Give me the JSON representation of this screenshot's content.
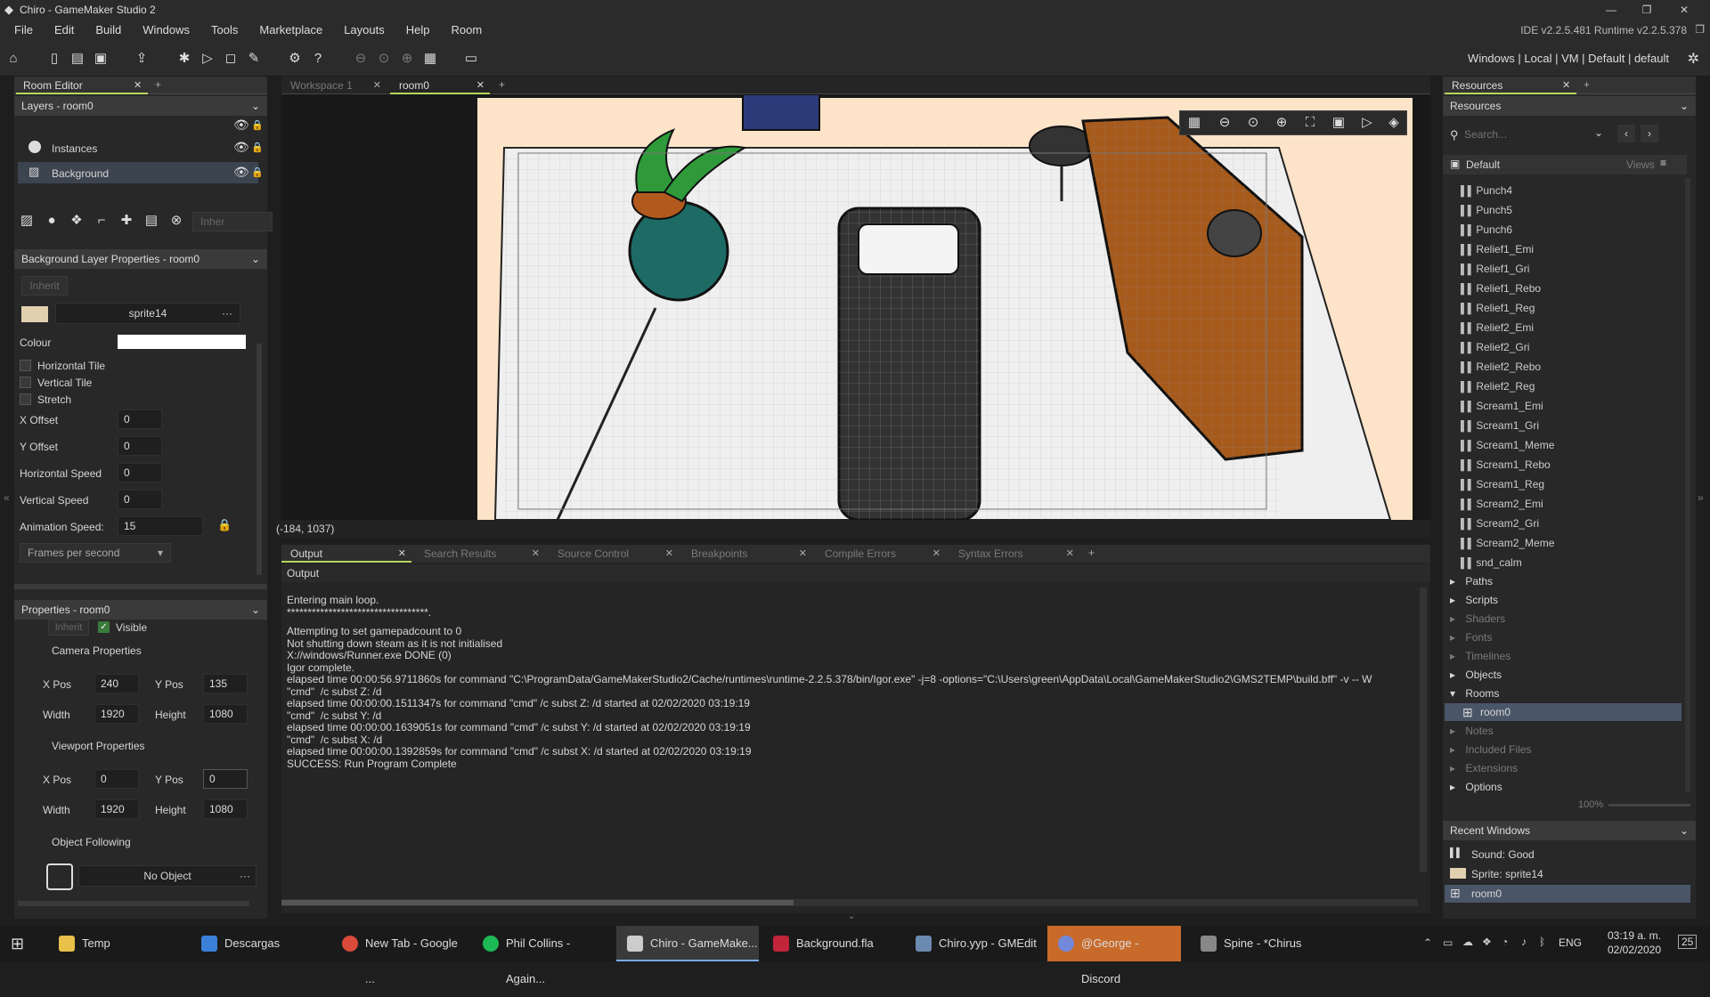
{
  "window": {
    "title": "Chiro - GameMaker Studio 2",
    "version": "IDE v2.2.5.481  Runtime v2.2.5.378"
  },
  "menu": [
    "File",
    "Edit",
    "Build",
    "Windows",
    "Tools",
    "Marketplace",
    "Layouts",
    "Help",
    "Room"
  ],
  "toolbar": {
    "targets": "Windows  |  Local  |  VM  |  Default  |  default"
  },
  "room_editor": {
    "tab": "Room Editor",
    "layers_header": "Layers - room0",
    "layers": [
      "Instances",
      "Background"
    ],
    "inherit_small": "Inher",
    "bg_props_header": "Background Layer Properties - room0",
    "inherit": "Inherit",
    "sprite": "sprite14",
    "colour_label": "Colour",
    "colour_value": "#ffffff",
    "checkboxes": [
      "Horizontal Tile",
      "Vertical Tile",
      "Stretch"
    ],
    "x_offset_label": "X Offset",
    "x_offset": "0",
    "y_offset_label": "Y Offset",
    "y_offset": "0",
    "hspeed_label": "Horizontal Speed",
    "hspeed": "0",
    "vspeed_label": "Vertical Speed",
    "vspeed": "0",
    "anim_speed_label": "Animation Speed:",
    "anim_speed": "15",
    "anim_unit": "Frames per second"
  },
  "room_props": {
    "header": "Properties - room0",
    "inherit": "Inherit",
    "visible": "Visible",
    "camera_title": "Camera Properties",
    "viewport_title": "Viewport Properties",
    "xpos_label": "X Pos",
    "ypos_label": "Y Pos",
    "width_label": "Width",
    "height_label": "Height",
    "camera": {
      "x": "240",
      "y": "135",
      "w": "1920",
      "h": "1080"
    },
    "viewport": {
      "x": "0",
      "y": "0",
      "w": "1920",
      "h": "1080"
    },
    "follow_title": "Object Following",
    "follow_value": "No Object"
  },
  "doc_tabs": [
    "Workspace 1",
    "room0"
  ],
  "coords": "(-184, 1037)",
  "output": {
    "tabs": [
      "Output",
      "Search Results",
      "Source Control",
      "Breakpoints",
      "Compile Errors",
      "Syntax Errors"
    ],
    "header": "Output",
    "lines": [
      "Entering main loop.",
      "**********************************.",
      "Attempting to set gamepadcount to 0",
      "Not shutting down steam as it is not initialised",
      "",
      "",
      "X://windows/Runner.exe DONE (0)",
      "Igor complete.",
      "elapsed time 00:00:56.9711860s for command \"C:\\ProgramData/GameMakerStudio2/Cache/runtimes\\runtime-2.2.5.378/bin/Igor.exe\" -j=8 -options=\"C:\\Users\\green\\AppData\\Local\\GameMakerStudio2\\GMS2TEMP\\build.bff\" -v -- W",
      "\"cmd\"  /c subst Z: /d",
      "",
      "elapsed time 00:00:00.1511347s for command \"cmd\" /c subst Z: /d started at 02/02/2020 03:19:19",
      "\"cmd\"  /c subst Y: /d",
      "",
      "elapsed time 00:00:00.1639051s for command \"cmd\" /c subst Y: /d started at 02/02/2020 03:19:19",
      "\"cmd\"  /c subst X: /d",
      "",
      "elapsed time 00:00:00.1392859s for command \"cmd\" /c subst X: /d started at 02/02/2020 03:19:19",
      "SUCCESS: Run Program Complete"
    ]
  },
  "resources": {
    "tab": "Resources",
    "header": "Resources",
    "search_placeholder": "Search...",
    "default_label": "Default",
    "views_label": "Views",
    "sounds": [
      "Punch4",
      "Punch5",
      "Punch6",
      "Relief1_Emi",
      "Relief1_Gri",
      "Relief1_Rebo",
      "Relief1_Reg",
      "Relief2_Emi",
      "Relief2_Gri",
      "Relief2_Rebo",
      "Relief2_Reg",
      "Scream1_Emi",
      "Scream1_Gri",
      "Scream1_Meme",
      "Scream1_Rebo",
      "Scream1_Reg",
      "Scream2_Emi",
      "Scream2_Gri",
      "Scream2_Meme",
      "snd_calm"
    ],
    "folders": [
      "Paths",
      "Scripts",
      "Shaders",
      "Fonts",
      "Timelines",
      "Objects",
      "Rooms"
    ],
    "room_item": "room0",
    "folders_after": [
      "Notes",
      "Included Files",
      "Extensions",
      "Options"
    ],
    "zoom": "100%",
    "recent_header": "Recent Windows",
    "recent": [
      "Sound: Good",
      "Sprite: sprite14",
      "room0"
    ]
  },
  "taskbar": {
    "items": [
      "Temp",
      "Descargas",
      "New Tab - Google ...",
      "Phil Collins - Again...",
      "Chiro - GameMake...",
      "Background.fla",
      "Chiro.yyp - GMEdit",
      "@George - Discord",
      "Spine - *Chirus"
    ],
    "lang": "ENG",
    "time": "03:19 a. m.",
    "date": "02/02/2020",
    "notif": "25"
  }
}
